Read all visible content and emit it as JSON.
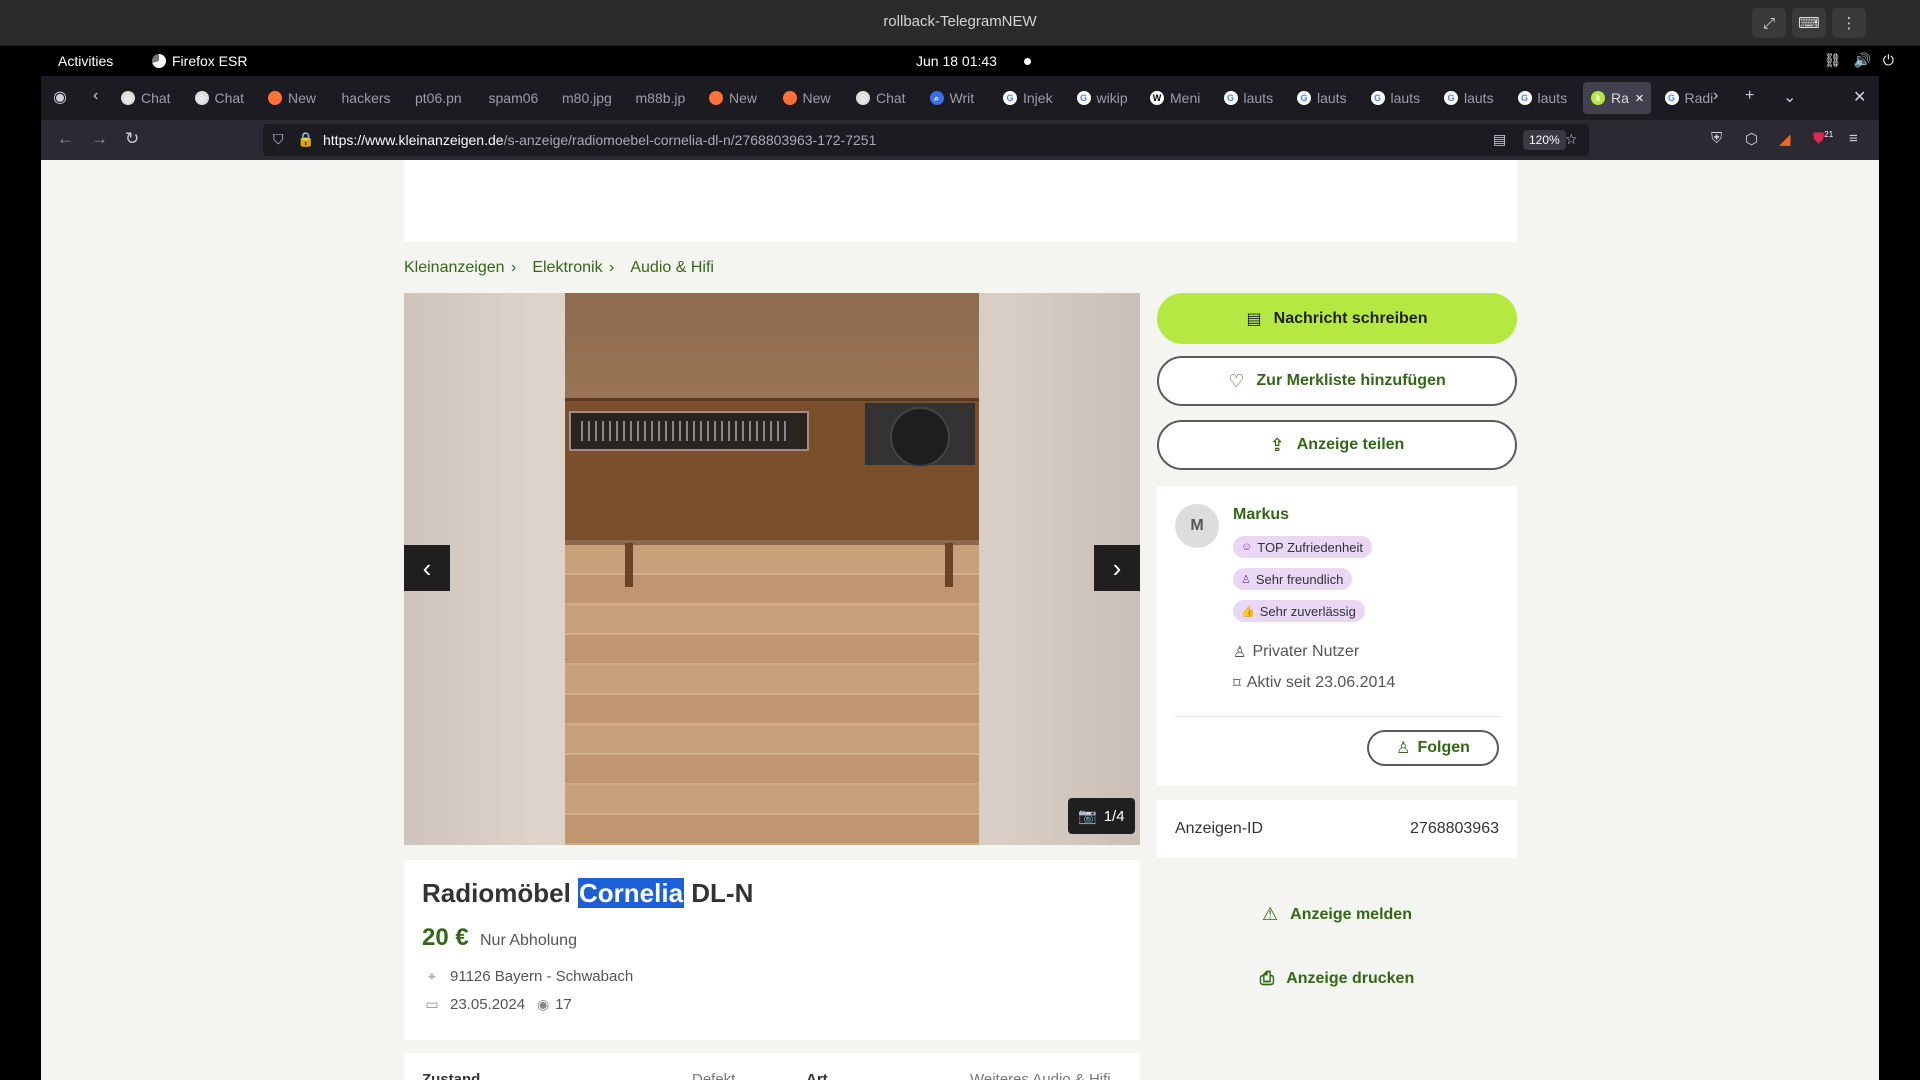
{
  "window": {
    "title": "rollback-TelegramNEW",
    "controls": [
      "expand-icon",
      "keyboard-icon",
      "more-icon"
    ]
  },
  "gnome": {
    "activities": "Activities",
    "app": "Firefox ESR",
    "clock": "Jun 18  01:43"
  },
  "tabs": [
    {
      "label": "Chat",
      "icon": "openai-icon"
    },
    {
      "label": "Chat",
      "icon": "openai-icon"
    },
    {
      "label": "New",
      "icon": "firefox-icon"
    },
    {
      "label": "hackers",
      "icon": ""
    },
    {
      "label": "pt06.pn",
      "icon": ""
    },
    {
      "label": "spam06",
      "icon": ""
    },
    {
      "label": "m80.jpg",
      "icon": ""
    },
    {
      "label": "m88b.jp",
      "icon": ""
    },
    {
      "label": "New",
      "icon": "firefox-icon"
    },
    {
      "label": "New",
      "icon": "firefox-icon"
    },
    {
      "label": "Chat",
      "icon": "openai-icon"
    },
    {
      "label": "Writ",
      "icon": "search-icon"
    },
    {
      "label": "Injek",
      "icon": "google-icon"
    },
    {
      "label": "wikip",
      "icon": "google-icon"
    },
    {
      "label": "Meni",
      "icon": "wikipedia-icon"
    },
    {
      "label": "lauts",
      "icon": "google-icon"
    },
    {
      "label": "lauts",
      "icon": "google-icon"
    },
    {
      "label": "lauts",
      "icon": "google-icon"
    },
    {
      "label": "lauts",
      "icon": "google-icon"
    },
    {
      "label": "lauts",
      "icon": "google-icon"
    },
    {
      "label": "Ra",
      "icon": "kleinanzeigen-icon",
      "active": true
    },
    {
      "label": "Radi",
      "icon": "google-icon"
    }
  ],
  "nav": {
    "url_host": "https://www.kleinanzeigen.de",
    "url_path": "/s-anzeige/radiomoebel-cornelia-dl-n/2768803963-172-7251",
    "zoom": "120%",
    "notification_count": "21"
  },
  "page": {
    "breadcrumb": [
      "Kleinanzeigen",
      "Elektronik",
      "Audio & Hifi"
    ],
    "gallery_counter": "1/4",
    "title_before": "Radiomöbel ",
    "title_highlight": "Cornelia",
    "title_after": " DL-N",
    "price": "20 €",
    "pickup": "Nur Abholung",
    "location": "91126 Bayern - Schwabach",
    "date": "23.05.2024",
    "views": "17",
    "details": {
      "k1": "Zustand",
      "v1": "Defekt",
      "k2": "Art",
      "v2": "Weiteres Audio & Hifi"
    }
  },
  "sidebar": {
    "message_btn": "Nachricht schreiben",
    "watchlist_btn": "Zur Merkliste hinzufügen",
    "share_btn": "Anzeige teilen",
    "seller": {
      "initial": "M",
      "name": "Markus",
      "badges": [
        "TOP Zufriedenheit",
        "Sehr freundlich",
        "Sehr zuverlässig"
      ],
      "type": "Privater Nutzer",
      "since": "Aktiv seit 23.06.2014",
      "follow": "Folgen"
    },
    "adid_label": "Anzeigen-ID",
    "adid_value": "2768803963",
    "report": "Anzeige melden",
    "print": "Anzeige drucken"
  },
  "colors": {
    "brand_green": "#326916",
    "accent_lime": "#b5e941",
    "badge_purple": "#e8d7f5",
    "selection_blue": "#1d5fd6"
  }
}
